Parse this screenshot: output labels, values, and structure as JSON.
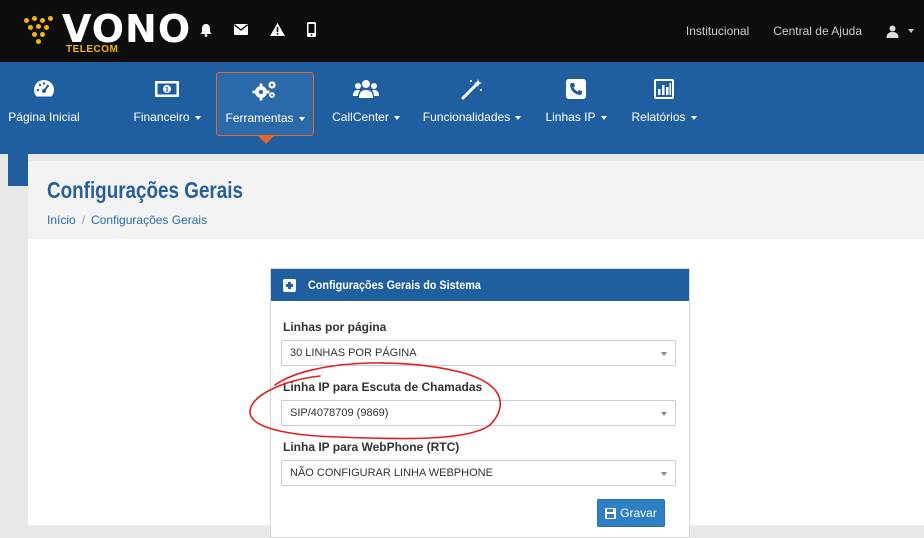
{
  "brand": {
    "name": "VONO",
    "sub": "TELECOM",
    "accent": "#f5b800"
  },
  "topbar": {
    "icons": [
      "bell-icon",
      "envelope-icon",
      "warning-icon",
      "mobile-icon"
    ],
    "links": [
      "Institucional",
      "Central de Ajuda"
    ],
    "user_icon": "user-icon"
  },
  "nav": {
    "items": [
      {
        "label": "Página Inicial",
        "icon": "dashboard-icon",
        "has_caret": false
      },
      {
        "label": "Financeiro",
        "icon": "money-icon",
        "has_caret": true
      },
      {
        "label": "Ferramentas",
        "icon": "gears-icon",
        "has_caret": true,
        "active": true
      },
      {
        "label": "CallCenter",
        "icon": "users-icon",
        "has_caret": true
      },
      {
        "label": "Funcionalidades",
        "icon": "magic-wand-icon",
        "has_caret": true
      },
      {
        "label": "Linhas IP",
        "icon": "phone-icon",
        "has_caret": true
      },
      {
        "label": "Relatórios",
        "icon": "bar-chart-icon",
        "has_caret": true
      }
    ],
    "bg": "#1f5f9f",
    "active_border": "#e8622a"
  },
  "page": {
    "title": "Configurações Gerais",
    "breadcrumb": [
      "Início",
      "Configurações Gerais"
    ]
  },
  "panel": {
    "title": "Configurações Gerais do Sistema",
    "fields": [
      {
        "label": "Linhas por página",
        "value": "30 LINHAS POR PÁGINA"
      },
      {
        "label": "Linha IP para Escuta de Chamadas",
        "value": "SIP/4078709 (9869)"
      },
      {
        "label": "Linha IP para WebPhone (RTC)",
        "value": "NÃO CONFIGURAR LINHA WEBPHONE"
      }
    ],
    "save_label": "Gravar"
  },
  "annotation": {
    "color": "#e02020"
  }
}
